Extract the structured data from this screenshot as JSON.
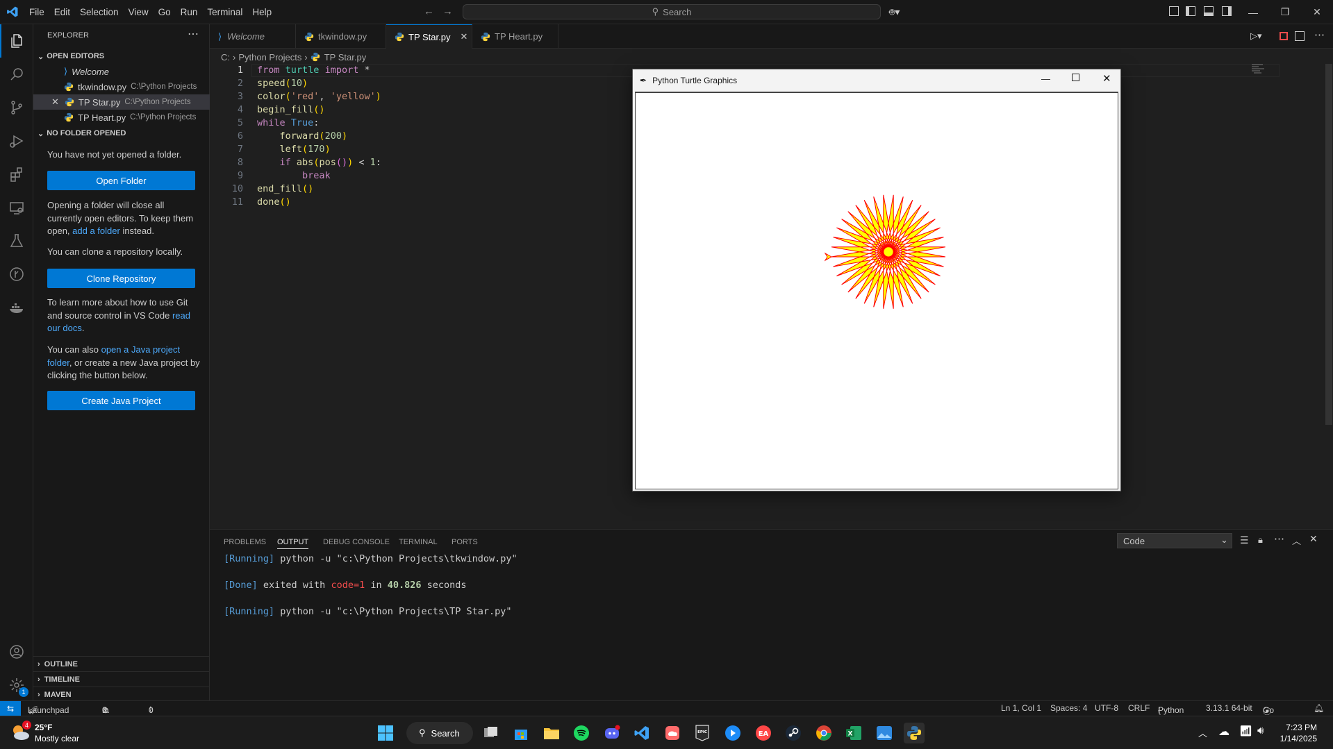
{
  "titlebar": {
    "menus": [
      "File",
      "Edit",
      "Selection",
      "View",
      "Go",
      "Run",
      "Terminal",
      "Help"
    ],
    "search_placeholder": "Search"
  },
  "sidebar": {
    "title": "EXPLORER",
    "open_editors_title": "OPEN EDITORS",
    "open_editors": [
      {
        "name": "Welcome",
        "path": ""
      },
      {
        "name": "tkwindow.py",
        "path": "C:\\Python Projects"
      },
      {
        "name": "TP Star.py",
        "path": "C:\\Python Projects"
      },
      {
        "name": "TP Heart.py",
        "path": "C:\\Python Projects"
      }
    ],
    "no_folder_title": "NO FOLDER OPENED",
    "p1": "You have not yet opened a folder.",
    "open_folder_label": "Open Folder",
    "p2a": "Opening a folder will close all currently open editors. To keep them open, ",
    "p2_link": "add a folder",
    "p2b": " instead.",
    "p3": "You can clone a repository locally.",
    "clone_label": "Clone Repository",
    "p4a": "To learn more about how to use Git and source control in VS Code ",
    "p4_link": "read our docs",
    "p4b": ".",
    "p5a": "You can also ",
    "p5_link": "open a Java project folder",
    "p5b": ", or create a new Java project by clicking the button below.",
    "create_java_label": "Create Java Project",
    "outline_label": "OUTLINE",
    "timeline_label": "TIMELINE",
    "maven_label": "MAVEN"
  },
  "tabs": [
    {
      "label": "Welcome",
      "active": false
    },
    {
      "label": "tkwindow.py",
      "active": false
    },
    {
      "label": "TP Star.py",
      "active": true
    },
    {
      "label": "TP Heart.py",
      "active": false
    }
  ],
  "breadcrumb": {
    "root": "C:",
    "folder": "Python Projects",
    "file": "TP Star.py"
  },
  "code_line_numbers": [
    "1",
    "2",
    "3",
    "4",
    "5",
    "6",
    "7",
    "8",
    "9",
    "10",
    "11"
  ],
  "turtle_window": {
    "title": "Python Turtle Graphics"
  },
  "panel": {
    "tabs": [
      "PROBLEMS",
      "OUTPUT",
      "DEBUG CONSOLE",
      "TERMINAL",
      "PORTS"
    ],
    "active_tab": "OUTPUT",
    "output_channel": "Code",
    "lines": {
      "l1_tag": "[Running]",
      "l1_cmd": " python -u \"c:\\Python Projects\\tkwindow.py\"",
      "l2_tag": "[Done]",
      "l2_a": " exited with ",
      "l2_code": "code=1",
      "l2_b": " in ",
      "l2_secs": "40.826",
      "l2_c": " seconds",
      "l3_tag": "[Running]",
      "l3_cmd": " python -u \"c:\\Python Projects\\TP Star.py\""
    }
  },
  "statusbar": {
    "launchpad": "Launchpad",
    "errors": "0",
    "warnings": "0",
    "ports": "0",
    "cursor": "Ln 1, Col 1",
    "spaces": "Spaces: 4",
    "encoding": "UTF-8",
    "eol": "CRLF",
    "language": "Python",
    "interpreter": "3.13.1 64-bit",
    "golive": "Go Live"
  },
  "taskbar": {
    "temp": "25°F",
    "weather": "Mostly clear",
    "weather_badge": "4",
    "search_label": "Search",
    "time": "7:23 PM",
    "date": "1/14/2025"
  },
  "colors": {
    "accent": "#0078d4",
    "star_fill": "#ffff00",
    "star_stroke": "#ff0000"
  }
}
